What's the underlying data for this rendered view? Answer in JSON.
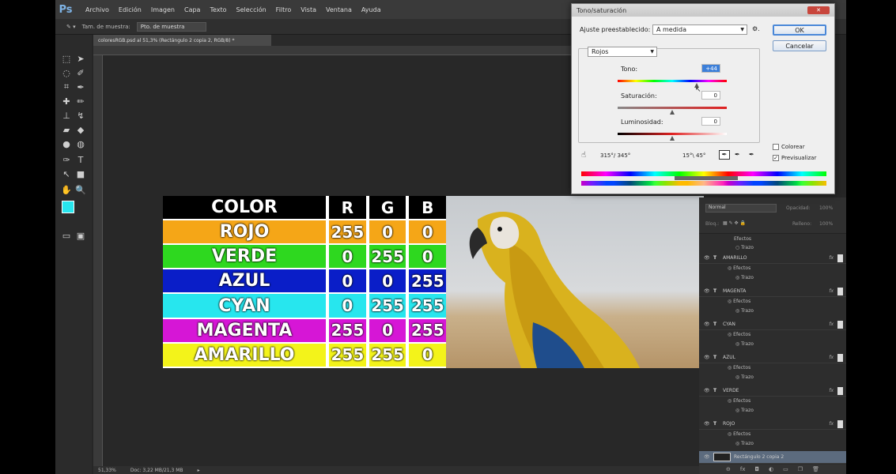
{
  "app": {
    "logo": "Ps",
    "menu": [
      "Archivo",
      "Edición",
      "Imagen",
      "Capa",
      "Texto",
      "Selección",
      "Filtro",
      "Vista",
      "Ventana",
      "Ayuda"
    ]
  },
  "options": {
    "sample_label": "Tam. de muestra:",
    "sample_value": "Pto. de muestra"
  },
  "document": {
    "tab_title": "coloresRGB.psd al 51,3% (Rectángulo 2 copia 2, RGB/8) *",
    "zoom": "51,33%",
    "doc_info": "Doc: 3,22 MB/21,3 MB"
  },
  "table": {
    "headers": [
      "COLOR",
      "R",
      "G",
      "B"
    ],
    "rows": [
      {
        "name": "ROJO",
        "r": "255",
        "g": "0",
        "b": "0",
        "bg": "#f5a617"
      },
      {
        "name": "VERDE",
        "r": "0",
        "g": "255",
        "b": "0",
        "bg": "#2ed81f"
      },
      {
        "name": "AZUL",
        "r": "0",
        "g": "0",
        "b": "255",
        "bg": "#0a1ec8"
      },
      {
        "name": "CYAN",
        "r": "0",
        "g": "255",
        "b": "255",
        "bg": "#27e6ee"
      },
      {
        "name": "MAGENTA",
        "r": "255",
        "g": "0",
        "b": "255",
        "bg": "#d616d6"
      },
      {
        "name": "AMARILLO",
        "r": "255",
        "g": "255",
        "b": "0",
        "bg": "#f3f31a"
      }
    ]
  },
  "dialog": {
    "title": "Tono/saturación",
    "preset_label": "Ajuste preestablecido:",
    "preset_value": "A medida",
    "channel": "Rojos",
    "ok": "OK",
    "cancel": "Cancelar",
    "hue_label": "Tono:",
    "hue_value": "+44",
    "saturation_label": "Saturación:",
    "saturation_value": "0",
    "lightness_label": "Luminosidad:",
    "lightness_value": "0",
    "range_left": "315°/ 345°",
    "range_right": "15°\\ 45°",
    "colorize_label": "Colorear",
    "preview_label": "Previsualizar",
    "preview_checked": true,
    "colorize_checked": false
  },
  "layers": {
    "blend_mode": "Normal",
    "opacity_label": "Opacidad:",
    "opacity_value": "100%",
    "lock_label": "Bloq.:",
    "fill_label": "Relleno:",
    "fill_value": "100%",
    "effects_label": "Efectos",
    "stroke_label": "Trazo",
    "items": [
      {
        "name": "AMARILLO"
      },
      {
        "name": "MAGENTA"
      },
      {
        "name": "CYAN"
      },
      {
        "name": "AZUL"
      },
      {
        "name": "VERDE"
      },
      {
        "name": "ROJO"
      }
    ],
    "selected_layer": "Rectángulo 2 copia 2"
  }
}
